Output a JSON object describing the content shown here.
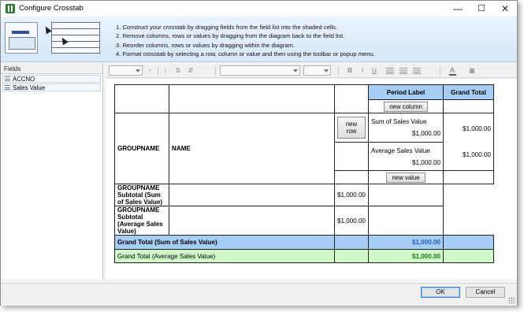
{
  "window": {
    "title": "Configure Crosstab",
    "controls": {
      "minimize": "—",
      "maximize": "☐",
      "close": "✕"
    }
  },
  "instructions": [
    "1. Construct your crosstab by dragging fields from the field list into the shaded cells.",
    "2. Remove columns, rows or values by dragging from the diagram back to the field list.",
    "3. Reorder columns, rows or values by dragging within the diagram.",
    "4. Format crosstab by selecting a row, column or value and then using the toolbar or popup menu."
  ],
  "fields": {
    "header": "Fields",
    "items": [
      "ACCNO",
      "Sales Value"
    ]
  },
  "toolbar": {
    "bold": "B",
    "italic": "I",
    "underline": "U",
    "font_color_glyph": "A",
    "icons": [
      "style-combo",
      "sort-asc-icon",
      "sort-desc-icon",
      "clear-sort-icon",
      "font-name-combo",
      "font-size-combo",
      "bold-icon",
      "italic-icon",
      "underline-icon",
      "align-left-icon",
      "align-center-icon",
      "align-right-icon",
      "font-color-icon",
      "fill-color-icon"
    ]
  },
  "crosstab": {
    "period_label": "Period Label",
    "grand_total_header": "Grand Total",
    "new_column": "new column",
    "groupname": "GROUPNAME",
    "name": "NAME",
    "new_row": "new row",
    "sum_label": "Sum of Sales Value",
    "avg_label": "Average Sales Value",
    "new_value": "new value",
    "sub_sum": "GROUPNAME Subtotal (Sum of Sales Value)",
    "sub_avg": "GROUPNAME Subtotal (Average Sales Value)",
    "gt_sum": "Grand Total (Sum of Sales Value)",
    "gt_avg": "Grand Total (Average Sales Value)",
    "amount": "$1,000.00"
  },
  "footer": {
    "ok": "OK",
    "cancel": "Cancel"
  },
  "colors": {
    "accent_blue": "#a6cdf4",
    "accent_green": "#cff7c8",
    "value_blue": "#1e5fc9",
    "value_green": "#1f7a1f"
  }
}
